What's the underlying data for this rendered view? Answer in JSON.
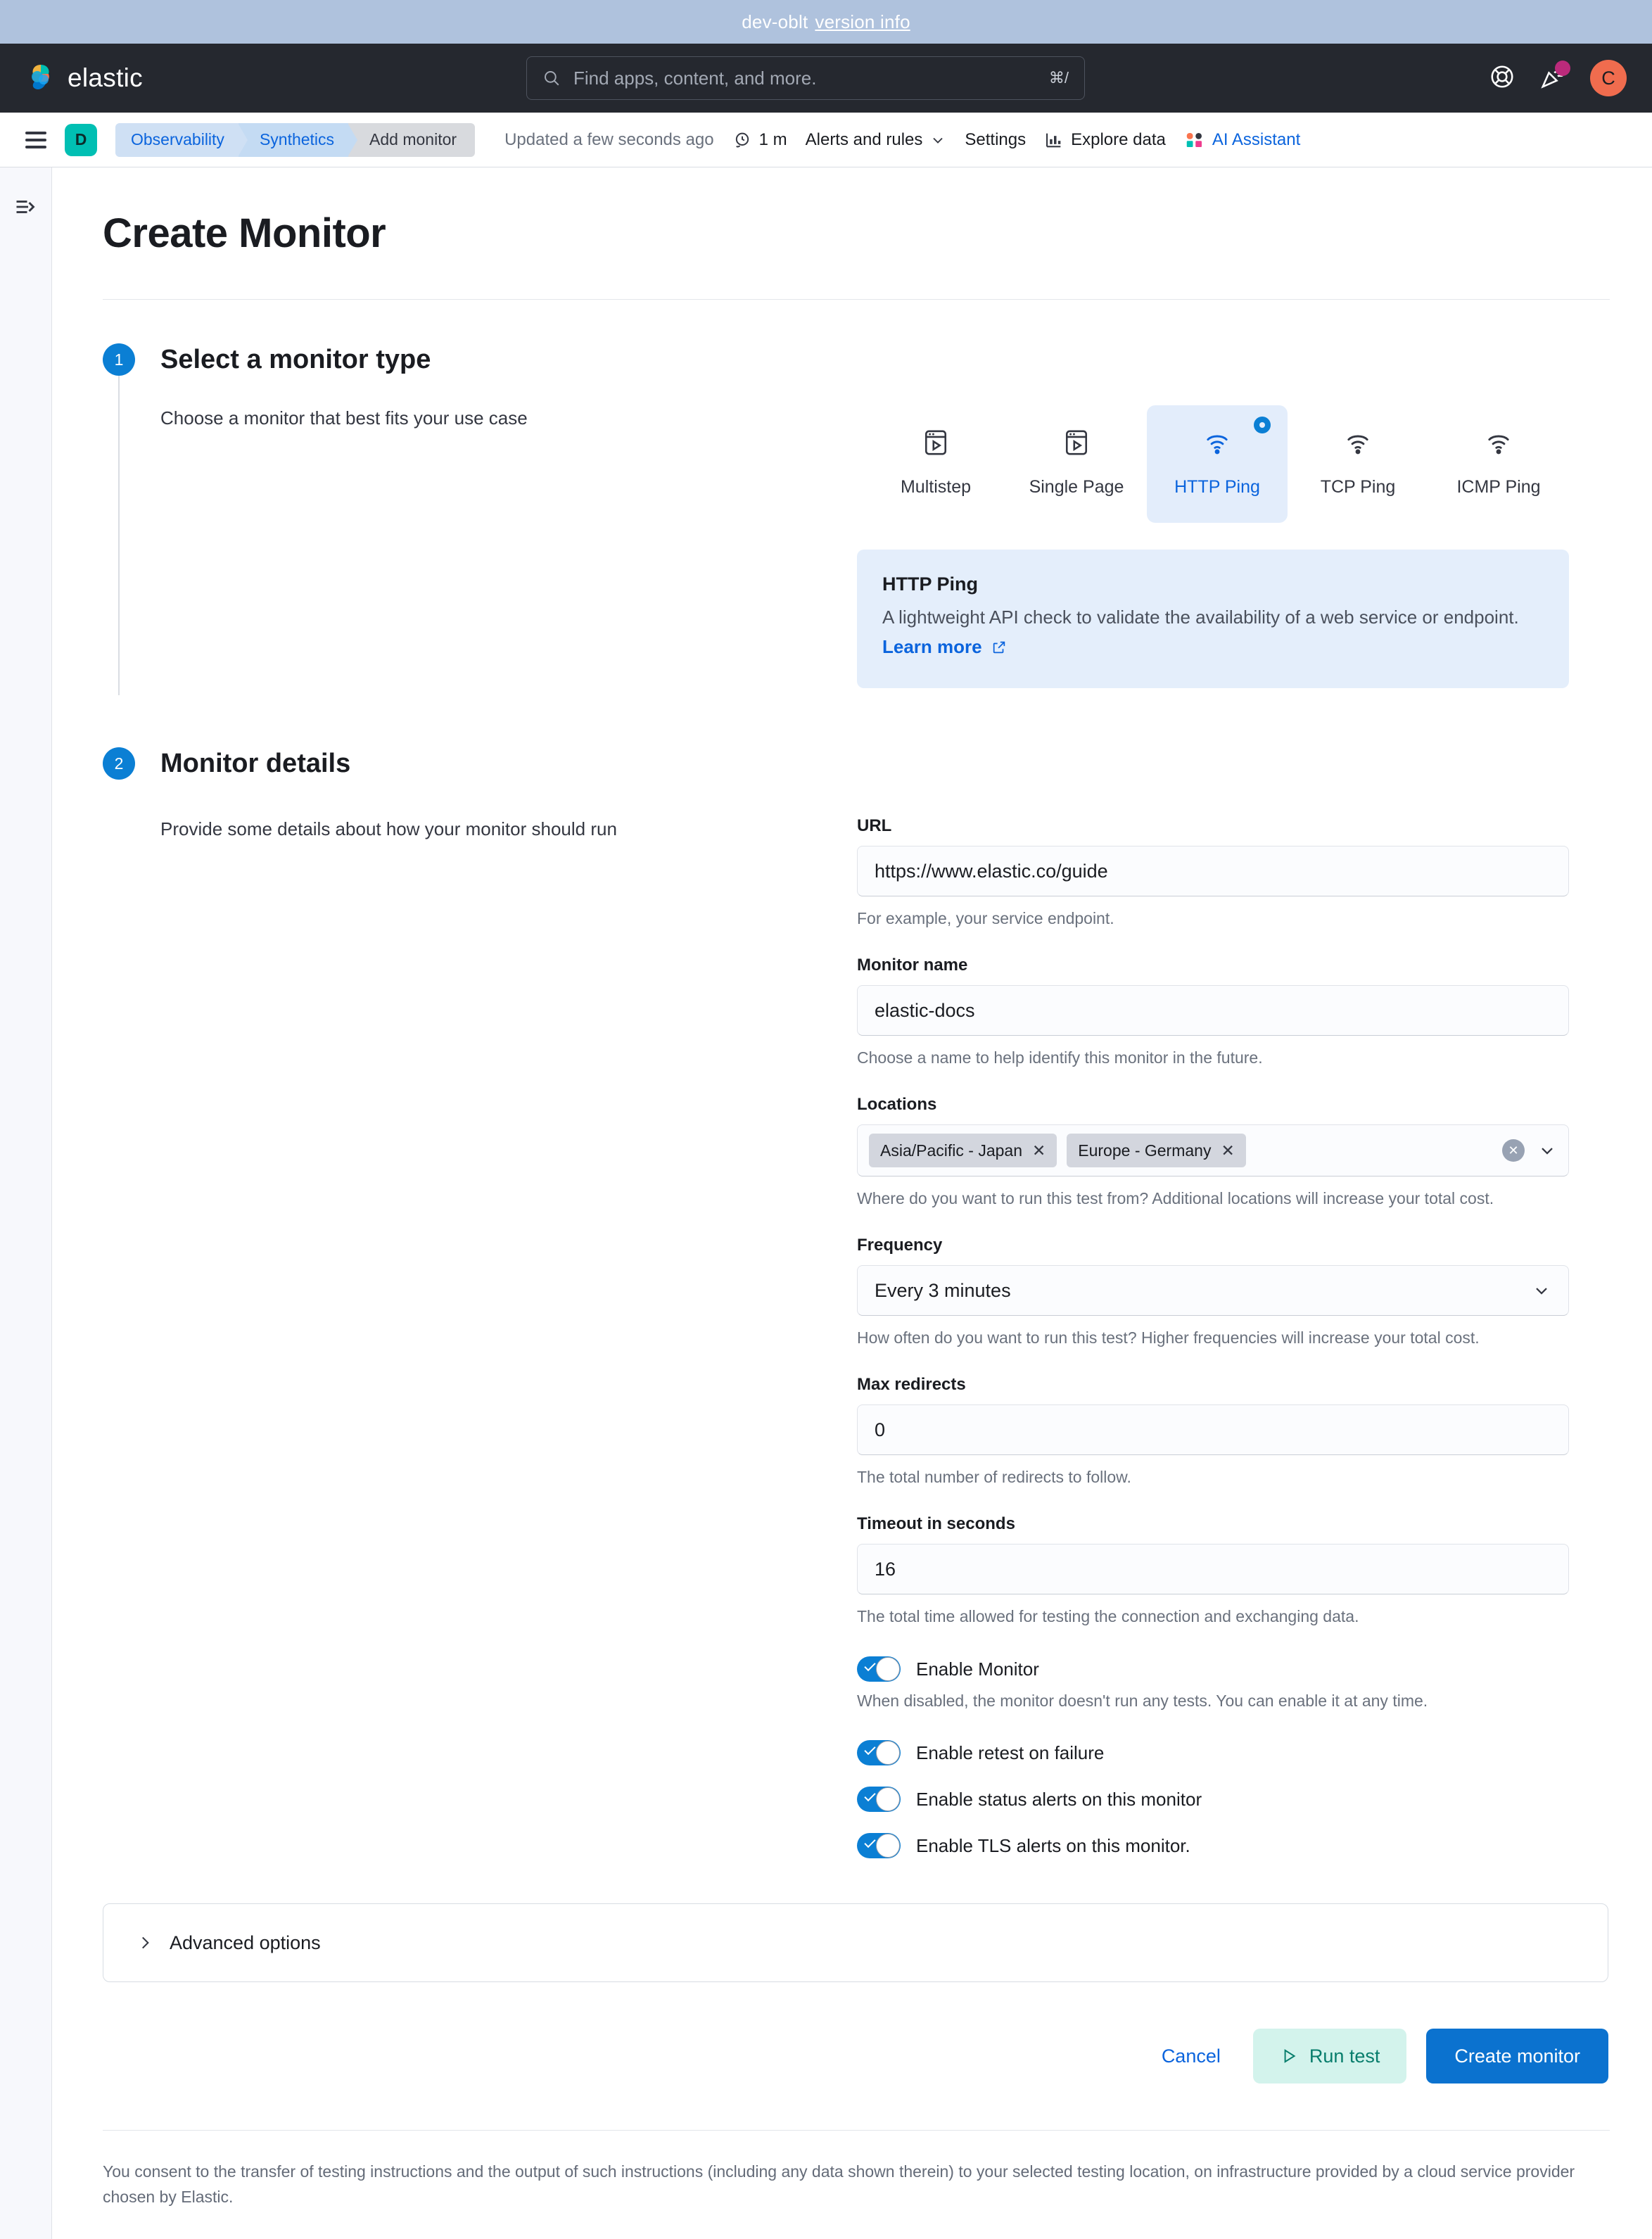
{
  "dev_banner": {
    "text": "dev-oblt",
    "link_label": "version info"
  },
  "chrome": {
    "brand_name": "elastic",
    "search_placeholder": "Find apps, content, and more.",
    "search_shortcut": "⌘/",
    "help_icon": "life-ring-icon",
    "announcements_icon": "cheer-icon",
    "avatar_initial": "C"
  },
  "toolbar": {
    "menu_icon": "hamburger-menu-icon",
    "space_badge": "D",
    "breadcrumbs": [
      {
        "label": "Observability"
      },
      {
        "label": "Synthetics"
      },
      {
        "label": "Add monitor"
      }
    ],
    "updated_text": "Updated a few seconds ago",
    "refresh_interval": "1 m",
    "alerts_and_rules": "Alerts and rules",
    "settings": "Settings",
    "explore_data": "Explore data",
    "ai_assistant": "AI Assistant"
  },
  "left_rail": {
    "toggle_icon": "expand-sidebar-icon"
  },
  "page": {
    "title": "Create Monitor"
  },
  "step1": {
    "number": "1",
    "title": "Select a monitor type",
    "description": "Choose a monitor that best fits your use case",
    "monitor_types": [
      {
        "label": "Multistep",
        "icon": "browser-play-icon",
        "selected": false
      },
      {
        "label": "Single Page",
        "icon": "browser-play-icon",
        "selected": false
      },
      {
        "label": "HTTP Ping",
        "icon": "ping-wifi-icon",
        "selected": true
      },
      {
        "label": "TCP Ping",
        "icon": "ping-wifi-icon",
        "selected": false
      },
      {
        "label": "ICMP Ping",
        "icon": "ping-wifi-icon",
        "selected": false
      }
    ],
    "callout": {
      "title": "HTTP Ping",
      "text": "A lightweight API check to validate the availability of a web service or endpoint.",
      "link_label": "Learn more",
      "link_icon": "external-link-icon"
    }
  },
  "step2": {
    "number": "2",
    "title": "Monitor details",
    "description": "Provide some details about how your monitor should run",
    "fields": {
      "url": {
        "label": "URL",
        "value": "https://www.elastic.co/guide",
        "help": "For example, your service endpoint."
      },
      "monitor_name": {
        "label": "Monitor name",
        "value": "elastic-docs",
        "help": "Choose a name to help identify this monitor in the future."
      },
      "locations": {
        "label": "Locations",
        "selected": [
          "Asia/Pacific - Japan",
          "Europe - Germany"
        ],
        "help": "Where do you want to run this test from? Additional locations will increase your total cost.",
        "clear_icon": "clear-all-icon",
        "chevron_icon": "chevron-down-icon"
      },
      "frequency": {
        "label": "Frequency",
        "value": "Every 3 minutes",
        "help": "How often do you want to run this test? Higher frequencies will increase your total cost.",
        "chevron_icon": "chevron-down-icon"
      },
      "max_redirects": {
        "label": "Max redirects",
        "value": "0",
        "help": "The total number of redirects to follow."
      },
      "timeout": {
        "label": "Timeout in seconds",
        "value": "16",
        "help": "The total time allowed for testing the connection and exchanging data."
      }
    },
    "toggles": [
      {
        "label": "Enable Monitor",
        "on": true,
        "help": "When disabled, the monitor doesn't run any tests. You can enable it at any time."
      },
      {
        "label": "Enable retest on failure",
        "on": true,
        "help": ""
      },
      {
        "label": "Enable status alerts on this monitor",
        "on": true,
        "help": ""
      },
      {
        "label": "Enable TLS alerts on this monitor.",
        "on": true,
        "help": ""
      }
    ]
  },
  "advanced": {
    "label": "Advanced options",
    "chevron_icon": "chevron-right-icon",
    "expanded": false
  },
  "actions": {
    "cancel_label": "Cancel",
    "run_test_label": "Run test",
    "run_test_icon": "play-icon",
    "create_label": "Create monitor"
  },
  "consent": {
    "text": "You consent to the transfer of testing instructions and the output of such instructions (including any data shown therein) to your selected testing location, on infrastructure provided by a cloud service provider chosen by Elastic."
  }
}
